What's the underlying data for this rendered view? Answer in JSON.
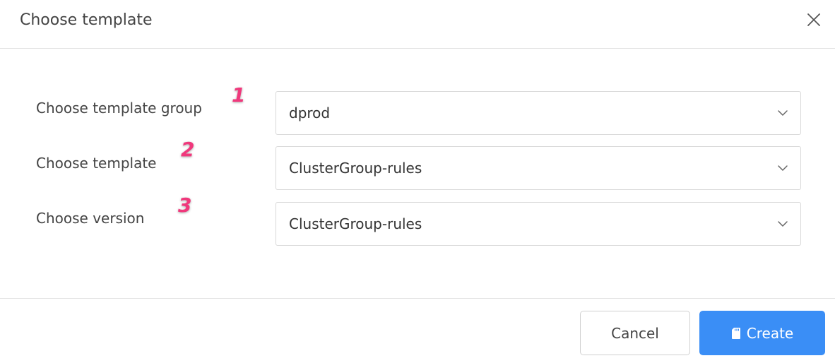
{
  "dialog": {
    "title": "Choose template",
    "close_icon": "close-icon"
  },
  "form": {
    "rows": [
      {
        "label": "Choose template group",
        "marker": "1",
        "value": "dprod"
      },
      {
        "label": "Choose template",
        "marker": "2",
        "value": "ClusterGroup-rules"
      },
      {
        "label": "Choose version",
        "marker": "3",
        "value": "ClusterGroup-rules"
      }
    ],
    "chevron_icon": "chevron-down-icon"
  },
  "footer": {
    "cancel_label": "Cancel",
    "create_label": "Create",
    "create_icon": "sd-card-icon"
  },
  "colors": {
    "primary": "#3a8ef6",
    "marker": "#f0387c",
    "border": "#d9d9d9",
    "text": "#444444"
  }
}
